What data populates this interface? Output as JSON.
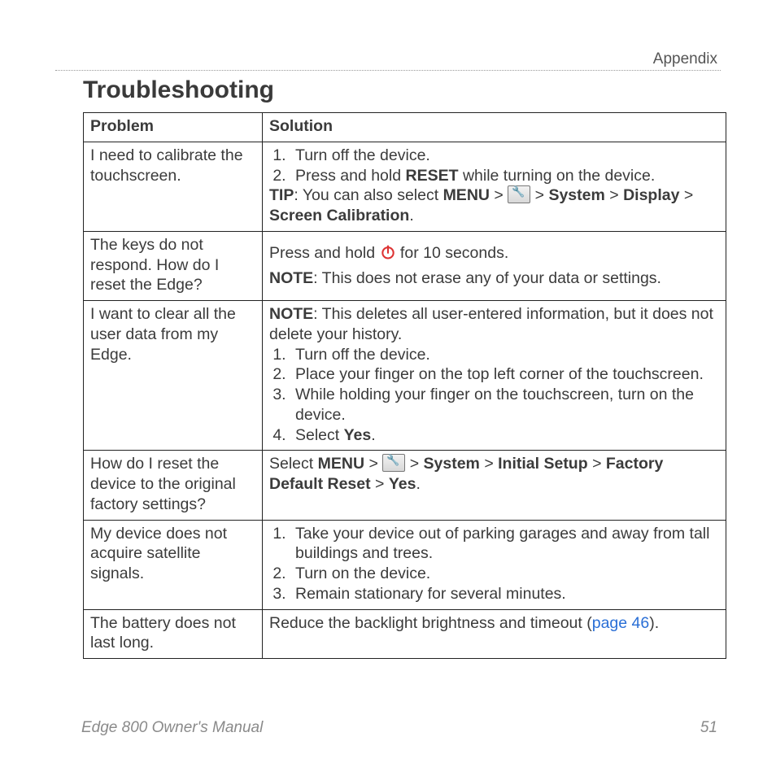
{
  "section_label": "Appendix",
  "title": "Troubleshooting",
  "table": {
    "header_problem": "Problem",
    "header_solution": "Solution",
    "rows": [
      {
        "problem": "I need to calibrate the touchscreen.",
        "solution": {
          "steps": [
            "Turn off the device.",
            {
              "pre": "Press and hold ",
              "bold": "RESET",
              "post": " while turning on the device."
            }
          ],
          "tip": {
            "label": "TIP",
            "pre": ": You can also select ",
            "menu_label": "MENU",
            "system": "System",
            "display": "Display",
            "screen_cal": "Screen Calibration"
          }
        }
      },
      {
        "problem": "The keys do not respond. How do I reset the Edge?",
        "solution": {
          "line1_pre": "Press and hold ",
          "line1_post": " for 10 seconds.",
          "note_label": "NOTE",
          "note": ": This does not erase any of your data or settings."
        }
      },
      {
        "problem": "I want to clear all the user data from my Edge.",
        "solution": {
          "note_label": "NOTE",
          "note": ": This deletes all user-entered information, but it does not delete your history.",
          "steps": [
            "Turn off the device.",
            "Place your finger on the top left corner of the touchscreen.",
            "While holding your finger on the touchscreen, turn on the device.",
            {
              "pre": "Select ",
              "bold": "Yes",
              "post": "."
            }
          ]
        }
      },
      {
        "problem": "How do I reset the device to the original factory settings?",
        "solution": {
          "pre": "Select ",
          "menu": "MENU",
          "system": "System",
          "initial": "Initial Setup",
          "factory": "Factory Default Reset",
          "yes": "Yes"
        }
      },
      {
        "problem": "My device does not acquire satellite signals.",
        "solution": {
          "steps": [
            "Take your device out of parking garages and away from tall buildings and trees.",
            "Turn on the device.",
            "Remain stationary for several minutes."
          ]
        }
      },
      {
        "problem": "The battery does not last long.",
        "solution": {
          "pre": "Reduce the backlight brightness and timeout (",
          "link_text": "page 46",
          "post": ")."
        }
      }
    ]
  },
  "footer": {
    "manual": "Edge 800 Owner's Manual",
    "page": "51"
  }
}
